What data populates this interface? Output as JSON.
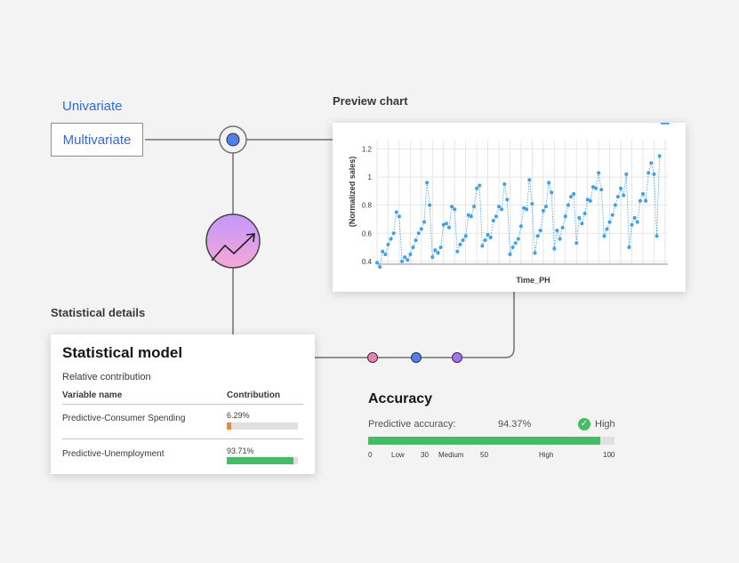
{
  "modes": {
    "univariate_label": "Univariate",
    "multivariate_label": "Multivariate"
  },
  "preview": {
    "heading": "Preview chart"
  },
  "stats": {
    "heading": "Statistical details",
    "title": "Statistical model",
    "subtitle": "Relative contribution",
    "col_variable": "Variable name",
    "col_contribution": "Contribution",
    "rows": [
      {
        "label": "Predictive-Consumer Spending",
        "value_text": "6.29%",
        "fraction": 0.0629,
        "color": "#ff832b"
      },
      {
        "label": "Predictive-Unemployment",
        "value_text": "93.71%",
        "fraction": 0.9371,
        "color": "#42be65"
      }
    ]
  },
  "accuracy": {
    "title": "Accuracy",
    "label": "Predictive accuracy:",
    "value_text": "94.37%",
    "fraction": 0.9437,
    "level": "High",
    "bar_color": "#42be65",
    "check_icon": "check-circle-icon",
    "scale": {
      "t0": "0",
      "low": "Low",
      "t30": "30",
      "medium": "Medium",
      "t50": "50",
      "high": "High",
      "t100": "100"
    }
  },
  "pipeline": {
    "node_colors": [
      "#ee7fb5",
      "#4f7ff0",
      "#a56eff"
    ],
    "hub_color": "#4f7ff0",
    "forecast_icon": "trend-up-icon"
  },
  "chart_data": {
    "type": "scatter",
    "title": "",
    "xlabel": "Time_PH",
    "ylabel": "(Normalized sales)",
    "ylim": [
      0.38,
      1.26
    ],
    "yticks": [
      "0.4",
      "0.6",
      "0.8",
      "1",
      "1.2"
    ],
    "grid": true,
    "series_color": "#3aa0f0",
    "x": [
      1,
      2,
      3,
      4,
      5,
      6,
      7,
      8,
      9,
      10,
      11,
      12,
      13,
      14,
      15,
      16,
      17,
      18,
      19,
      20,
      21,
      22,
      23,
      24,
      25,
      26,
      27,
      28,
      29,
      30,
      31,
      32,
      33,
      34,
      35,
      36,
      37,
      38,
      39,
      40,
      41,
      42,
      43,
      44,
      45,
      46,
      47,
      48,
      49,
      50,
      51,
      52,
      53,
      54,
      55,
      56,
      57,
      58,
      59,
      60,
      61,
      62,
      63,
      64,
      65,
      66,
      67,
      68,
      69,
      70,
      71,
      72,
      73,
      74,
      75,
      76,
      77,
      78,
      79,
      80,
      81,
      82,
      83,
      84,
      85,
      86,
      87,
      88,
      89,
      90,
      91,
      92,
      93,
      94,
      95,
      96,
      97,
      98,
      99,
      100,
      101,
      102,
      103,
      104,
      105,
      106
    ],
    "y": [
      0.39,
      0.36,
      0.47,
      0.45,
      0.52,
      0.56,
      0.6,
      0.75,
      0.72,
      0.4,
      0.43,
      0.41,
      0.45,
      0.5,
      0.55,
      0.6,
      0.63,
      0.68,
      0.96,
      0.8,
      0.43,
      0.48,
      0.46,
      0.5,
      0.66,
      0.67,
      0.64,
      0.79,
      0.77,
      0.47,
      0.52,
      0.55,
      0.58,
      0.73,
      0.72,
      0.79,
      0.92,
      0.94,
      0.51,
      0.55,
      0.59,
      0.57,
      0.69,
      0.72,
      0.79,
      0.77,
      0.95,
      0.84,
      0.45,
      0.5,
      0.53,
      0.56,
      0.65,
      0.78,
      0.77,
      0.98,
      0.81,
      0.46,
      0.58,
      0.62,
      0.76,
      0.79,
      0.96,
      0.89,
      0.49,
      0.62,
      0.56,
      0.64,
      0.72,
      0.8,
      0.86,
      0.88,
      0.53,
      0.71,
      0.67,
      0.74,
      0.84,
      0.83,
      0.93,
      0.92,
      1.03,
      0.91,
      0.58,
      0.63,
      0.68,
      0.73,
      0.8,
      0.86,
      0.92,
      0.87,
      1.02,
      0.5,
      0.66,
      0.71,
      0.68,
      0.83,
      0.88,
      0.83,
      1.03,
      1.1,
      1.02,
      0.58,
      1.15
    ]
  }
}
